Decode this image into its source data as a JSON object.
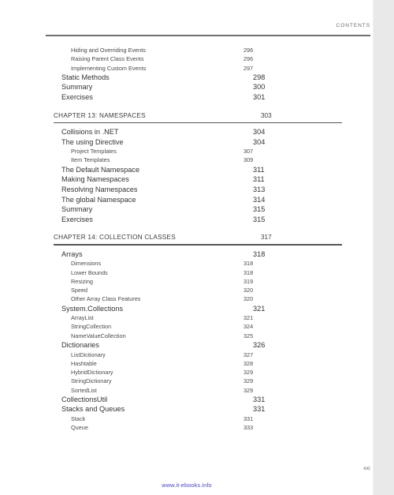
{
  "page": {
    "running_head": "CONTENTS",
    "folio": "xxi",
    "footer_link": "www.it-ebooks.info",
    "accent_link_color": "#4a4ac6",
    "rule_color": "#555555",
    "text_color": "#3a3a3a",
    "edge_strip_color": "#e9e9e9"
  },
  "toc": {
    "lead_entries": [
      {
        "level": 2,
        "label": "Hiding and Overriding Events",
        "page": "296"
      },
      {
        "level": 2,
        "label": "Raising Parent Class Events",
        "page": "296"
      },
      {
        "level": 2,
        "label": "Implementing Custom Events",
        "page": "297"
      },
      {
        "level": 1,
        "label": "Static Methods",
        "page": "298"
      },
      {
        "level": 1,
        "label": "Summary",
        "page": "300"
      },
      {
        "level": 1,
        "label": "Exercises",
        "page": "301"
      }
    ],
    "chapters": [
      {
        "title": "CHAPTER 13: NAMESPACES",
        "page": "303",
        "entries": [
          {
            "level": 1,
            "label": "Collisions in .NET",
            "page": "304"
          },
          {
            "level": 1,
            "label": "The using Directive",
            "page": "304"
          },
          {
            "level": 2,
            "label": "Project Templates",
            "page": "307"
          },
          {
            "level": 2,
            "label": "Item Templates",
            "page": "309"
          },
          {
            "level": 1,
            "label": "The Default Namespace",
            "page": "311"
          },
          {
            "level": 1,
            "label": "Making Namespaces",
            "page": "311"
          },
          {
            "level": 1,
            "label": "Resolving Namespaces",
            "page": "313"
          },
          {
            "level": 1,
            "label": "The global Namespace",
            "page": "314"
          },
          {
            "level": 1,
            "label": "Summary",
            "page": "315"
          },
          {
            "level": 1,
            "label": "Exercises",
            "page": "315"
          }
        ]
      },
      {
        "title": "CHAPTER 14: COLLECTION CLASSES",
        "page": "317",
        "entries": [
          {
            "level": 1,
            "label": "Arrays",
            "page": "318"
          },
          {
            "level": 2,
            "label": "Dimensions",
            "page": "318"
          },
          {
            "level": 2,
            "label": "Lower Bounds",
            "page": "318"
          },
          {
            "level": 2,
            "label": "Resizing",
            "page": "319"
          },
          {
            "level": 2,
            "label": "Speed",
            "page": "320"
          },
          {
            "level": 2,
            "label": "Other Array Class Features",
            "page": "320"
          },
          {
            "level": 1,
            "label": "System.Collections",
            "page": "321"
          },
          {
            "level": 2,
            "label": "ArrayList",
            "page": "321"
          },
          {
            "level": 2,
            "label": "StringCollection",
            "page": "324"
          },
          {
            "level": 2,
            "label": "NameValueCollection",
            "page": "325"
          },
          {
            "level": 1,
            "label": "Dictionaries",
            "page": "326"
          },
          {
            "level": 2,
            "label": "ListDictionary",
            "page": "327"
          },
          {
            "level": 2,
            "label": "Hashtable",
            "page": "328"
          },
          {
            "level": 2,
            "label": "HybridDictionary",
            "page": "329"
          },
          {
            "level": 2,
            "label": "StringDictionary",
            "page": "329"
          },
          {
            "level": 2,
            "label": "SortedList",
            "page": "329"
          },
          {
            "level": 1,
            "label": "CollectionsUtil",
            "page": "331"
          },
          {
            "level": 1,
            "label": "Stacks and Queues",
            "page": "331"
          },
          {
            "level": 2,
            "label": "Stack",
            "page": "331"
          },
          {
            "level": 2,
            "label": "Queue",
            "page": "333"
          }
        ]
      }
    ]
  }
}
